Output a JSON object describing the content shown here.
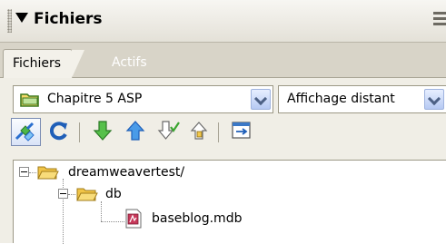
{
  "panel": {
    "title": "Fichiers"
  },
  "tabs": [
    {
      "label": "Fichiers",
      "selected": true
    },
    {
      "label": "Actifs",
      "selected": false
    }
  ],
  "site_select": {
    "value": "Chapitre 5 ASP"
  },
  "view_select": {
    "value": "Affichage distant"
  },
  "toolbar": [
    {
      "name": "connect-icon",
      "pressed": true
    },
    {
      "name": "refresh-icon"
    },
    {
      "name": "get-files-icon"
    },
    {
      "name": "put-files-icon"
    },
    {
      "name": "check-out-icon"
    },
    {
      "name": "check-in-icon"
    },
    {
      "name": "expand-view-icon"
    }
  ],
  "tree": [
    {
      "label": "dreamweavertest/",
      "type": "folder",
      "expanded": true,
      "level": 0
    },
    {
      "label": "db",
      "type": "folder",
      "expanded": true,
      "level": 1
    },
    {
      "label": "baseblog.mdb",
      "type": "file",
      "level": 2
    }
  ],
  "colors": {
    "titlebar": "#e9e7e0",
    "tabstrip": "#d8d4c8",
    "content_bg": "#f0eee6",
    "folder": "#f2c84b",
    "arrow_green": "#3aa52f",
    "arrow_blue": "#2f73c9"
  }
}
